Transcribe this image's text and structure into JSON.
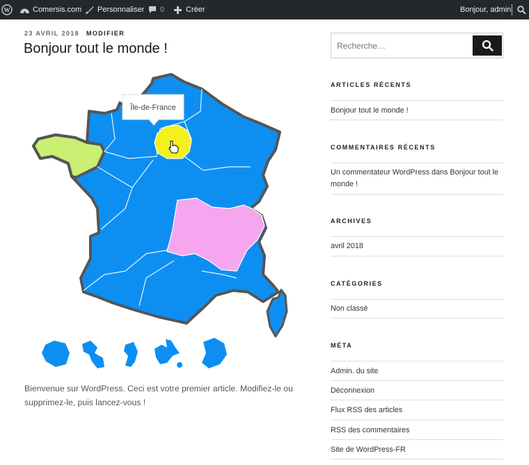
{
  "adminbar": {
    "site_name": "Comersis.com",
    "customize": "Personnaliser",
    "comments_count": "0",
    "new_label": "Créer",
    "greeting": "Bonjour, admin"
  },
  "post": {
    "date": "23 AVRIL 2018",
    "edit": "MODIFIER",
    "title": "Bonjour tout le monde !",
    "body": "Bienvenue sur WordPress. Ceci est votre premier article. Modifiez-le ou supprimez-le, puis lancez-vous !"
  },
  "map": {
    "tooltip": "Île-de-France",
    "colors": {
      "default": "#0d8ff2",
      "bretagne": "#c9ef73",
      "idf": "#f3f01c",
      "bourgogne": "#f6a6ef",
      "outline": "#555555"
    }
  },
  "sidebar": {
    "search_placeholder": "Recherche…",
    "recent_posts": {
      "title": "ARTICLES RÉCENTS",
      "items": [
        "Bonjour tout le monde !"
      ]
    },
    "recent_comments": {
      "title": "COMMENTAIRES RÉCENTS",
      "items": [
        "Un commentateur WordPress dans Bonjour tout le monde !"
      ]
    },
    "archives": {
      "title": "ARCHIVES",
      "items": [
        "avril 2018"
      ]
    },
    "categories": {
      "title": "CATÉGORIES",
      "items": [
        "Non classé"
      ]
    },
    "meta": {
      "title": "MÉTA",
      "items": [
        "Admin. du site",
        "Déconnexion",
        "Flux RSS des articles",
        "RSS des commentaires",
        "Site de WordPress-FR"
      ]
    }
  }
}
